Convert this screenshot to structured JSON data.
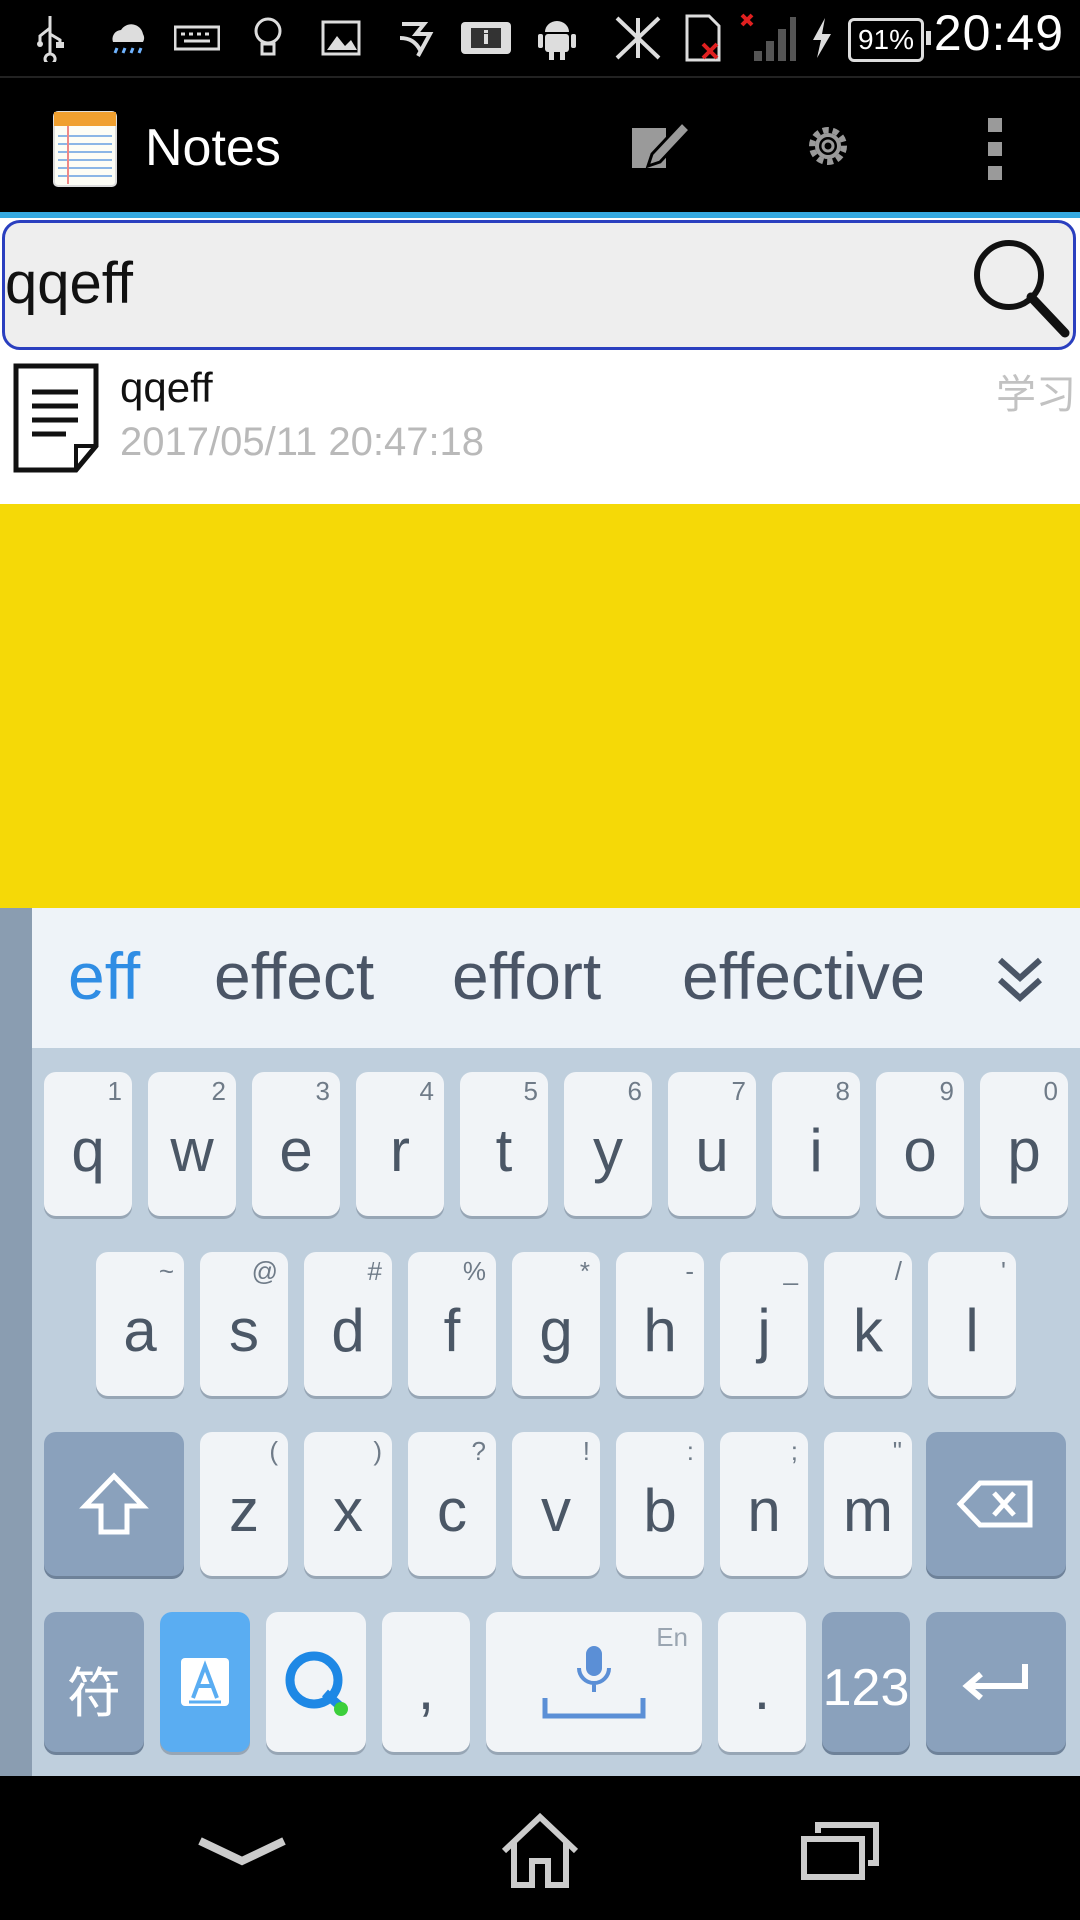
{
  "status_bar": {
    "icons": [
      "usb-icon",
      "weather-cloud-icon",
      "keyboard-icon",
      "lightbulb-icon",
      "image-icon",
      "app-icon",
      "info-card-icon",
      "android-icon",
      "no-sync-icon",
      "sd-card-error-icon",
      "no-signal-icon",
      "charging-icon"
    ],
    "battery": "91%",
    "time": "20:49"
  },
  "action_bar": {
    "title": "Notes",
    "actions": [
      "new-note-icon",
      "settings-icon",
      "overflow-menu-icon"
    ]
  },
  "search": {
    "value": "qqeff",
    "placeholder": ""
  },
  "notes": [
    {
      "title": "qqeff",
      "date": "2017/05/11 20:47:18",
      "category": "学习"
    }
  ],
  "colors": {
    "content_background": "#f5d907",
    "search_border": "#2a3fbf",
    "accent": "#36a9e1",
    "suggestion_active": "#2f8de4"
  },
  "keyboard": {
    "suggestions": [
      "eff",
      "effect",
      "effort",
      "effective"
    ],
    "row1": [
      {
        "label": "q",
        "hint": "1"
      },
      {
        "label": "w",
        "hint": "2"
      },
      {
        "label": "e",
        "hint": "3"
      },
      {
        "label": "r",
        "hint": "4"
      },
      {
        "label": "t",
        "hint": "5"
      },
      {
        "label": "y",
        "hint": "6"
      },
      {
        "label": "u",
        "hint": "7"
      },
      {
        "label": "i",
        "hint": "8"
      },
      {
        "label": "o",
        "hint": "9"
      },
      {
        "label": "p",
        "hint": "0"
      }
    ],
    "row2": [
      {
        "label": "a",
        "hint": "~"
      },
      {
        "label": "s",
        "hint": "@"
      },
      {
        "label": "d",
        "hint": "#"
      },
      {
        "label": "f",
        "hint": "%"
      },
      {
        "label": "g",
        "hint": "*"
      },
      {
        "label": "h",
        "hint": "-"
      },
      {
        "label": "j",
        "hint": "_"
      },
      {
        "label": "k",
        "hint": "/"
      },
      {
        "label": "l",
        "hint": "'"
      }
    ],
    "row3": [
      {
        "label": "z",
        "hint": "("
      },
      {
        "label": "x",
        "hint": ")"
      },
      {
        "label": "c",
        "hint": "?"
      },
      {
        "label": "v",
        "hint": "!"
      },
      {
        "label": "b",
        "hint": ":"
      },
      {
        "label": "n",
        "hint": ";"
      },
      {
        "label": "m",
        "hint": "\""
      }
    ],
    "symbols_key": "符",
    "comma": ",",
    "period": ".",
    "space_hint": "En",
    "numbers_key": "123"
  },
  "nav_bar": [
    "back-icon",
    "home-icon",
    "recents-icon"
  ]
}
